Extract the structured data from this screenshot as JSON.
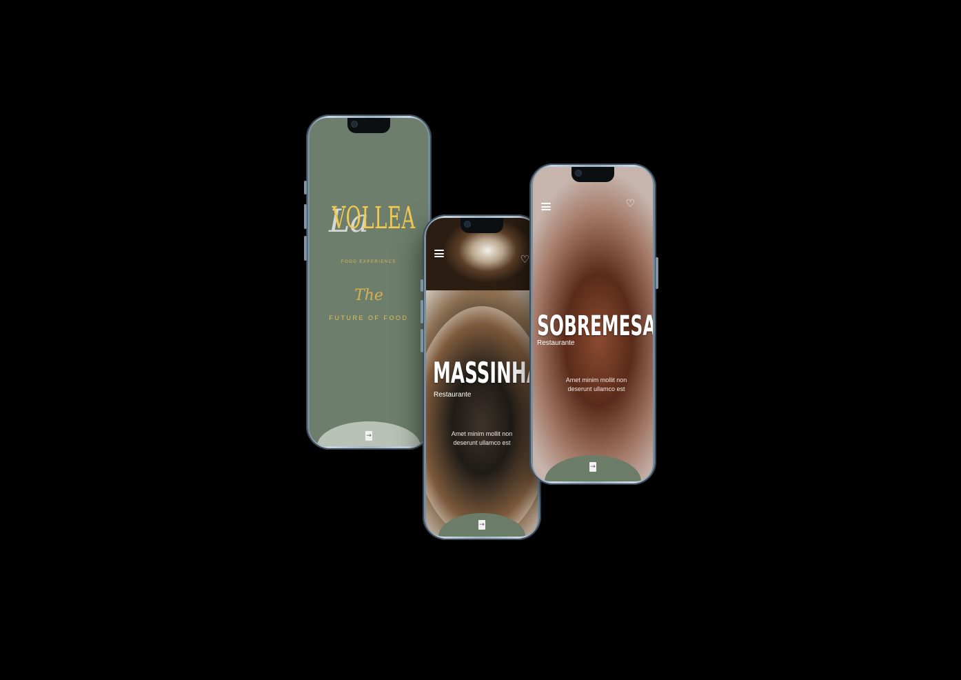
{
  "phone1": {
    "logo_text": "VOLLEA",
    "logo_script": "La",
    "logo_subtitle": "FOOD EXPERIENCE",
    "tagline_script": "The",
    "tagline": "FUTURE OF FOOD",
    "enter_icon": "enter-icon",
    "background_color": "#6d7f6c",
    "accent_color": "#f3c94e"
  },
  "phone2": {
    "title": "MASSINHAS",
    "subtitle": "Restaurante",
    "description_line1": "Amet minim mollit non",
    "description_line2": "deserunt ullamco est",
    "menu_icon": "hamburger-icon",
    "favorite_icon": "heart-icon",
    "enter_icon": "enter-icon"
  },
  "phone3": {
    "title": "SOBREMESAS",
    "subtitle": "Restaurante",
    "description_line1": "Amet minim mollit non",
    "description_line2": "deserunt ullamco est",
    "menu_icon": "hamburger-icon",
    "favorite_icon": "heart-icon",
    "enter_icon": "enter-icon"
  }
}
